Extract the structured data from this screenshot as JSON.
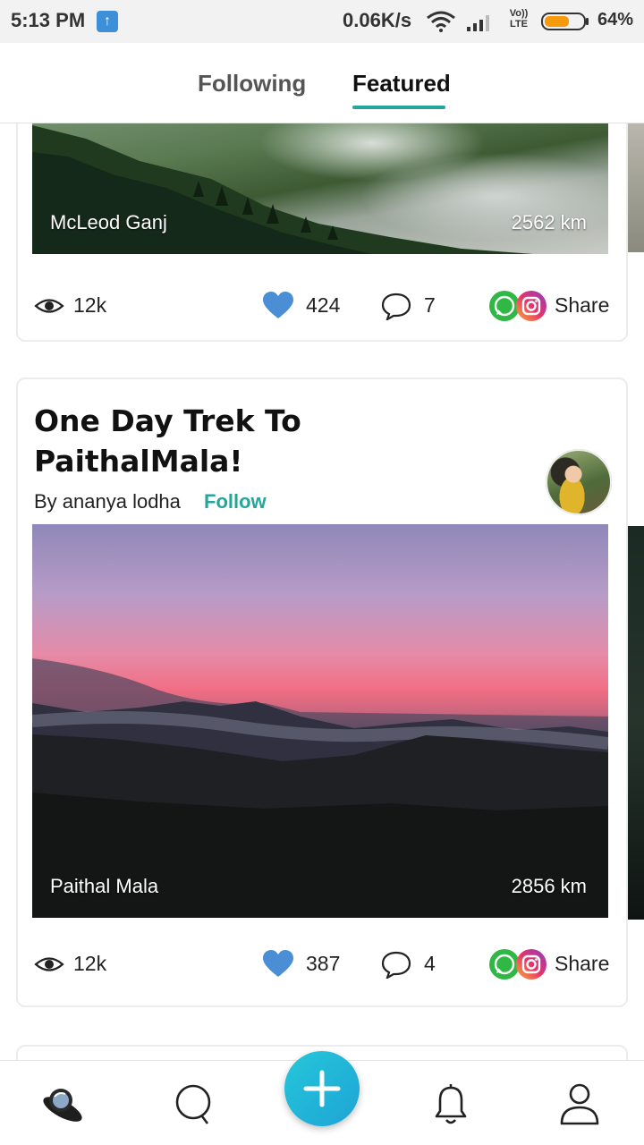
{
  "status_bar": {
    "time": "5:13 PM",
    "network_speed": "0.06K/s",
    "network_type": "LTE",
    "volte_label": "Vo))",
    "battery_percent": "64%",
    "battery_level": 0.64,
    "battery_color": "#f59a0b"
  },
  "tabs": [
    {
      "label": "Following",
      "active": false
    },
    {
      "label": "Featured",
      "active": true
    }
  ],
  "accent_color": "#26a69a",
  "cards": [
    {
      "photo_place": "McLeod Ganj",
      "photo_distance": "2562 km",
      "views": "12k",
      "likes": "424",
      "comments": "7",
      "share_label": "Share"
    },
    {
      "title": "One Day Trek To PaithalMala!",
      "byline": "By ananya lodha",
      "follow_label": "Follow",
      "photo_place": "Paithal Mala",
      "photo_distance": "2856 km",
      "views": "12k",
      "likes": "387",
      "comments": "4",
      "share_label": "Share"
    }
  ],
  "bottom_nav": [
    {
      "icon": "ufo-home-icon",
      "active": true
    },
    {
      "icon": "search-icon",
      "active": false
    },
    {
      "icon": "plus-icon",
      "active": false
    },
    {
      "icon": "bell-icon",
      "active": false
    },
    {
      "icon": "profile-icon",
      "active": false
    }
  ]
}
